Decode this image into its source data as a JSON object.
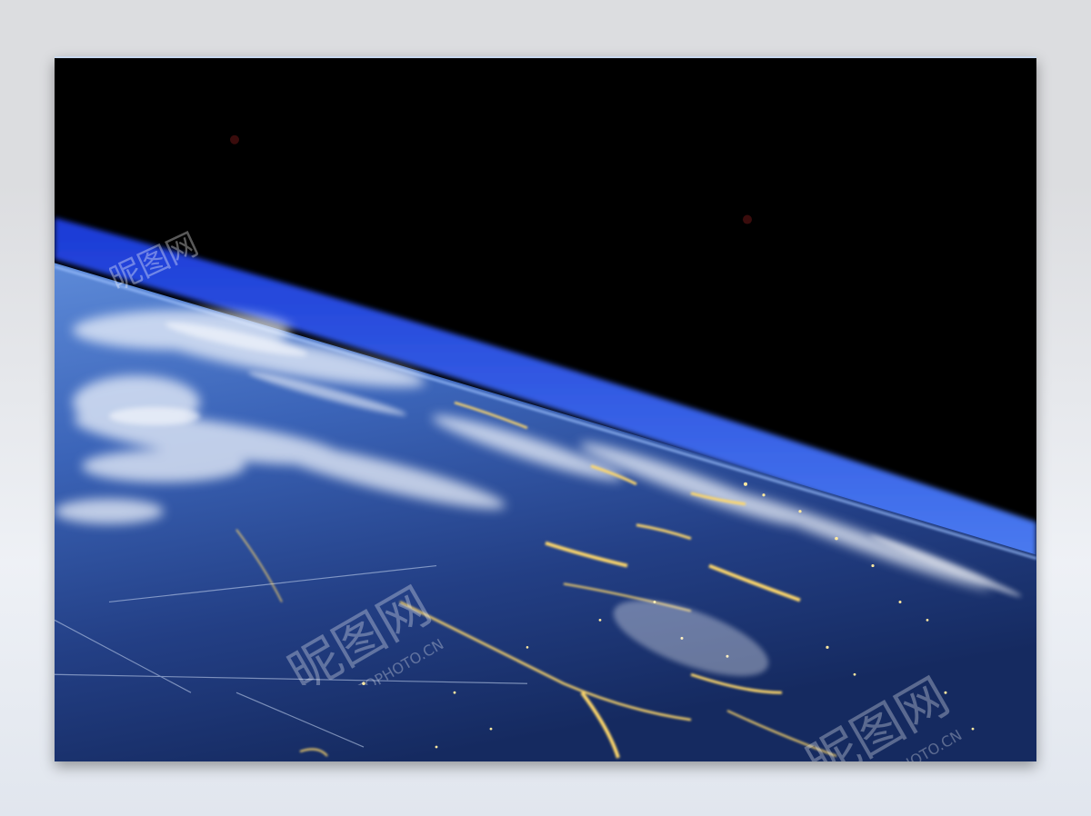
{
  "image": {
    "subject": "Earth at night from orbit",
    "colors": {
      "space": "#000000",
      "atmosphere": "#2f5fd8",
      "ocean": "#1e3a7a",
      "cloud": "#e8eef8",
      "city_lights": "#ffd86a",
      "page_background": "#dcdde0"
    }
  },
  "watermark": {
    "logo_text": "昵图网",
    "url_text": "PHOTOPHOTO.CN"
  }
}
